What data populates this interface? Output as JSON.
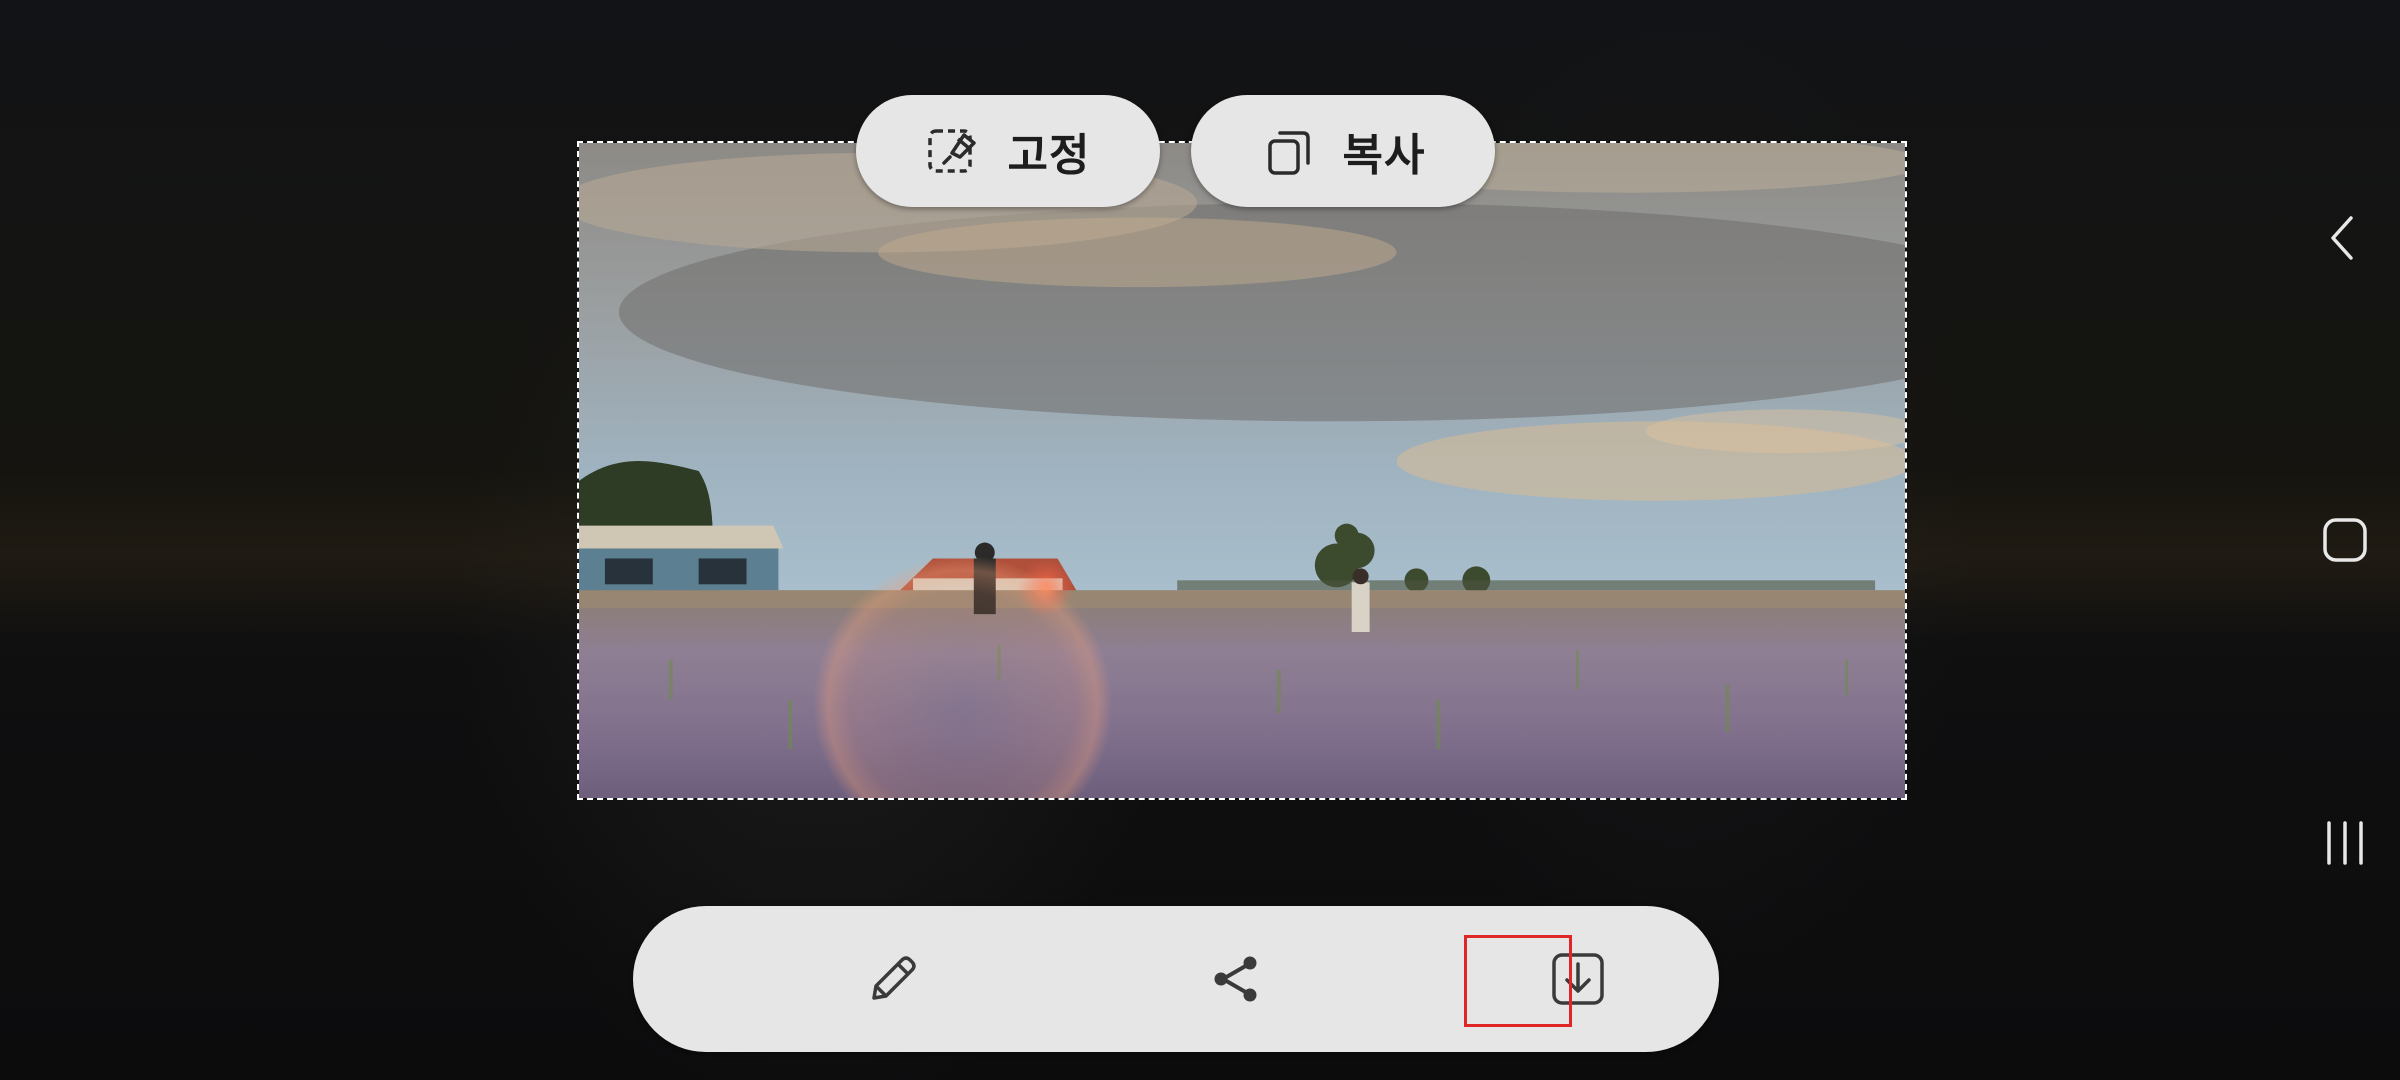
{
  "screen": {
    "pin_button_label": "고정",
    "copy_button_label": "복사"
  },
  "icons": {
    "pin": "pin-to-screen-icon",
    "copy": "copy-icon",
    "edit": "pencil-icon",
    "share": "share-icon",
    "save": "download-icon",
    "back": "chevron-left-icon",
    "home": "home-square-icon",
    "recents": "recents-bars-icon"
  },
  "colors": {
    "pill_bg": "#e7e6e6",
    "icon": "#2b2b2b",
    "highlight": "#e02727",
    "nav_icon": "#e8e8e8"
  }
}
